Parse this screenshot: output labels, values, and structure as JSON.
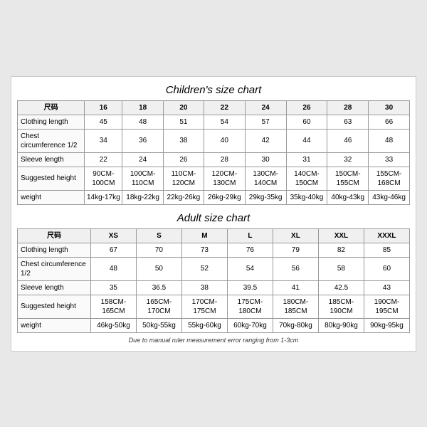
{
  "children_chart": {
    "title": "Children's size chart",
    "columns": [
      "尺码",
      "16",
      "18",
      "20",
      "22",
      "24",
      "26",
      "28",
      "30"
    ],
    "rows": [
      {
        "label": "Clothing length",
        "values": [
          "45",
          "48",
          "51",
          "54",
          "57",
          "60",
          "63",
          "66"
        ]
      },
      {
        "label": "Chest circumference 1/2",
        "values": [
          "34",
          "36",
          "38",
          "40",
          "42",
          "44",
          "46",
          "48"
        ]
      },
      {
        "label": "Sleeve length",
        "values": [
          "22",
          "24",
          "26",
          "28",
          "30",
          "31",
          "32",
          "33"
        ]
      },
      {
        "label": "Suggested height",
        "values": [
          "90CM-100CM",
          "100CM-110CM",
          "110CM-120CM",
          "120CM-130CM",
          "130CM-140CM",
          "140CM-150CM",
          "150CM-155CM",
          "155CM-168CM"
        ]
      },
      {
        "label": "weight",
        "values": [
          "14kg-17kg",
          "18kg-22kg",
          "22kg-26kg",
          "26kg-29kg",
          "29kg-35kg",
          "35kg-40kg",
          "40kg-43kg",
          "43kg-46kg"
        ]
      }
    ]
  },
  "adult_chart": {
    "title": "Adult size chart",
    "columns": [
      "尺码",
      "XS",
      "S",
      "M",
      "L",
      "XL",
      "XXL",
      "XXXL"
    ],
    "rows": [
      {
        "label": "Clothing length",
        "values": [
          "67",
          "70",
          "73",
          "76",
          "79",
          "82",
          "85"
        ]
      },
      {
        "label": "Chest circumference 1/2",
        "values": [
          "48",
          "50",
          "52",
          "54",
          "56",
          "58",
          "60"
        ]
      },
      {
        "label": "Sleeve length",
        "values": [
          "35",
          "36.5",
          "38",
          "39.5",
          "41",
          "42.5",
          "43"
        ]
      },
      {
        "label": "Suggested height",
        "values": [
          "158CM-165CM",
          "165CM-170CM",
          "170CM-175CM",
          "175CM-180CM",
          "180CM-185CM",
          "185CM-190CM",
          "190CM-195CM"
        ]
      },
      {
        "label": "weight",
        "values": [
          "46kg-50kg",
          "50kg-55kg",
          "55kg-60kg",
          "60kg-70kg",
          "70kg-80kg",
          "80kg-90kg",
          "90kg-95kg"
        ]
      }
    ]
  },
  "footer": {
    "note": "Due to manual ruler measurement error ranging from 1-3cm"
  }
}
